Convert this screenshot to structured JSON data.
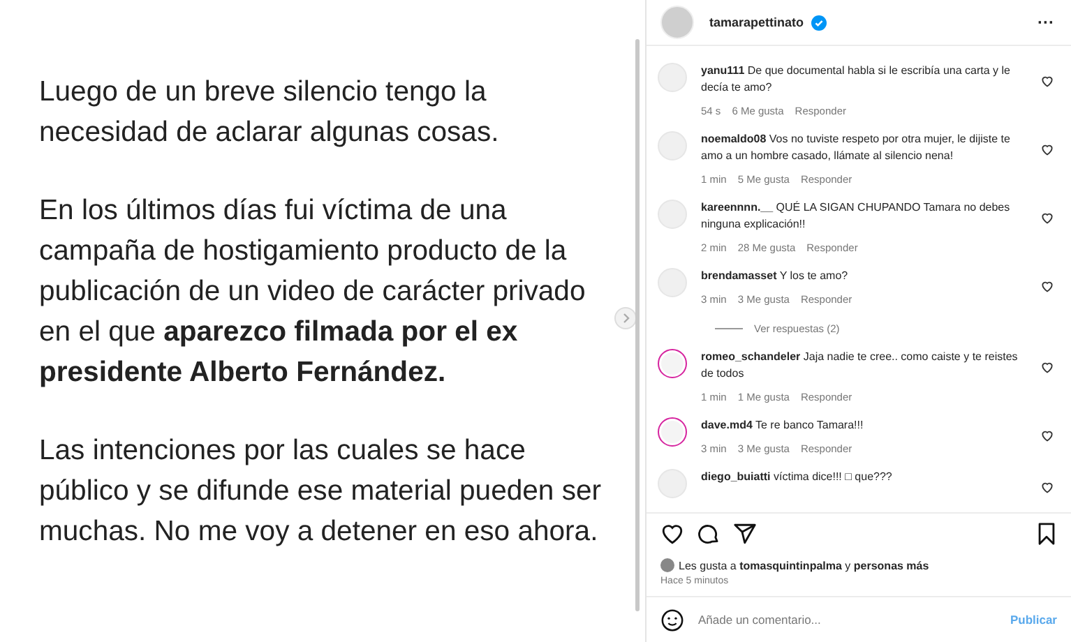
{
  "post": {
    "paragraphs": [
      "Luego de un breve silencio tengo la necesidad de aclarar algunas cosas.",
      "En los últimos días fui víctima de una campaña de hostigamiento producto de la publicación de un video de carácter privado en el que **aparezco filmada por el ex presidente Alberto Fernández.**",
      "Las intenciones por las cuales se hace público y se difunde ese material pueden ser muchas. No me voy a detener en eso ahora."
    ]
  },
  "header": {
    "username": "tamarapettinato",
    "verified": true,
    "more": "···"
  },
  "comments": [
    {
      "username": "yanu111",
      "text": "De que documental habla si le escribía una carta y le decía te amo?",
      "time": "54 s",
      "likes": "6 Me gusta",
      "reply": "Responder",
      "story_ring": false
    },
    {
      "username": "noemaldo08",
      "text": "Vos no tuviste respeto por otra mujer, le dijiste te amo a un hombre casado, llámate al silencio nena!",
      "time": "1 min",
      "likes": "5 Me gusta",
      "reply": "Responder",
      "story_ring": false
    },
    {
      "username": "kareennnn.__",
      "text": "QUÉ LA SIGAN CHUPANDO Tamara no debes ninguna explicación!!",
      "time": "2 min",
      "likes": "28 Me gusta",
      "reply": "Responder",
      "story_ring": false
    },
    {
      "username": "brendamasset",
      "text": "Y los te amo?",
      "time": "3 min",
      "likes": "3 Me gusta",
      "reply": "Responder",
      "story_ring": false,
      "replies": "Ver respuestas (2)"
    },
    {
      "username": "romeo_schandeler",
      "text": "Jaja nadie te cree.. como caiste y te reistes de todos",
      "time": "1 min",
      "likes": "1 Me gusta",
      "reply": "Responder",
      "story_ring": true
    },
    {
      "username": "dave.md4",
      "text": "Te re banco Tamara!!!",
      "time": "3 min",
      "likes": "3 Me gusta",
      "reply": "Responder",
      "story_ring": true
    },
    {
      "username": "diego_buiatti",
      "text": "víctima dice!!! □ que???",
      "story_ring": false
    }
  ],
  "likes_line": "Les gusta a **tomasquintinpalma** y **personas más**",
  "posted": "Hace 5 minutos",
  "comment_field": {
    "placeholder": "Añade un comentario...",
    "submit": "Publicar"
  }
}
